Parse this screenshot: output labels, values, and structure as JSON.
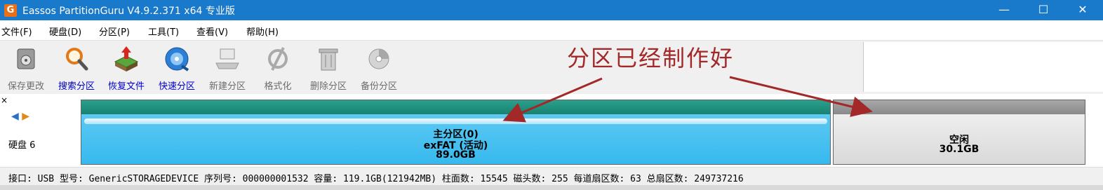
{
  "window": {
    "title": "Eassos PartitionGuru V4.9.2.371 x64 专业版",
    "app_icon_letter": "G",
    "minimize_glyph": "—",
    "maximize_glyph": "☐",
    "close_glyph": "✕"
  },
  "menu": [
    "文件(F)",
    "硬盘(D)",
    "分区(P)",
    "工具(T)",
    "查看(V)",
    "帮助(H)"
  ],
  "toolbar": {
    "buttons": [
      {
        "label": "保存更改",
        "icon": "save-icon",
        "enabled": false
      },
      {
        "label": "搜索分区",
        "icon": "search-icon",
        "enabled": true
      },
      {
        "label": "恢复文件",
        "icon": "restore-icon",
        "enabled": true
      },
      {
        "label": "快速分区",
        "icon": "quick-partition-icon",
        "enabled": true
      },
      {
        "label": "新建分区",
        "icon": "new-partition-icon",
        "enabled": false
      },
      {
        "label": "格式化",
        "icon": "format-icon",
        "enabled": false
      },
      {
        "label": "删除分区",
        "icon": "delete-icon",
        "enabled": false
      },
      {
        "label": "备份分区",
        "icon": "backup-icon",
        "enabled": false
      }
    ]
  },
  "annotation": "分区已经制作好",
  "disk": {
    "label": "硬盘 6",
    "nav_left": "◀",
    "nav_right": "▶",
    "close_mark": "×",
    "partitions": [
      {
        "name": "主分区(0)",
        "fs": "exFAT (活动)",
        "size": "89.0GB"
      },
      {
        "name": "空闲",
        "size": "30.1GB"
      }
    ]
  },
  "info": "接口: USB  型号: GenericSTORAGEDEVICE  序列号: 000000001532  容量: 119.1GB(121942MB)  柱面数: 15545  磁头数: 255  每道扇区数: 63  总扇区数: 249737216",
  "colors": {
    "titlebar": "#1979ca",
    "annotation": "#a32828",
    "primary_strip": "#1e8d7a",
    "primary_fill": "#37b9ee",
    "free_fill": "#d9d9d9"
  }
}
